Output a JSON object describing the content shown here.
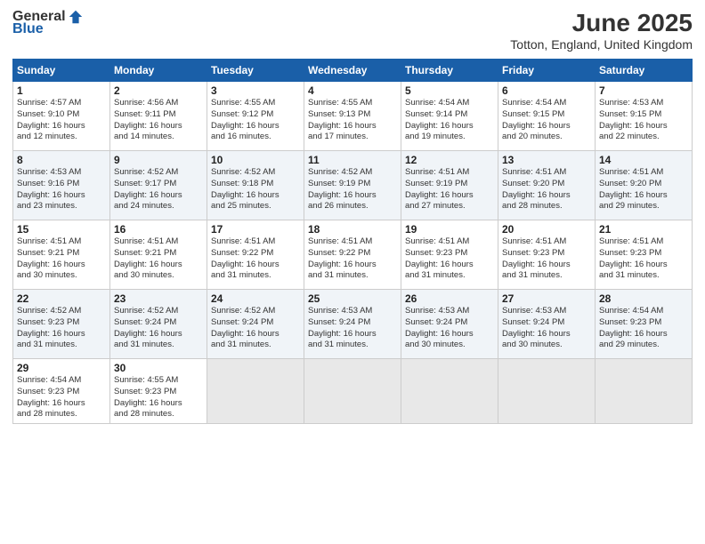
{
  "header": {
    "logo_general": "General",
    "logo_blue": "Blue",
    "title": "June 2025",
    "subtitle": "Totton, England, United Kingdom"
  },
  "calendar": {
    "days_of_week": [
      "Sunday",
      "Monday",
      "Tuesday",
      "Wednesday",
      "Thursday",
      "Friday",
      "Saturday"
    ],
    "weeks": [
      [
        {
          "day": "1",
          "info": "Sunrise: 4:57 AM\nSunset: 9:10 PM\nDaylight: 16 hours\nand 12 minutes."
        },
        {
          "day": "2",
          "info": "Sunrise: 4:56 AM\nSunset: 9:11 PM\nDaylight: 16 hours\nand 14 minutes."
        },
        {
          "day": "3",
          "info": "Sunrise: 4:55 AM\nSunset: 9:12 PM\nDaylight: 16 hours\nand 16 minutes."
        },
        {
          "day": "4",
          "info": "Sunrise: 4:55 AM\nSunset: 9:13 PM\nDaylight: 16 hours\nand 17 minutes."
        },
        {
          "day": "5",
          "info": "Sunrise: 4:54 AM\nSunset: 9:14 PM\nDaylight: 16 hours\nand 19 minutes."
        },
        {
          "day": "6",
          "info": "Sunrise: 4:54 AM\nSunset: 9:15 PM\nDaylight: 16 hours\nand 20 minutes."
        },
        {
          "day": "7",
          "info": "Sunrise: 4:53 AM\nSunset: 9:15 PM\nDaylight: 16 hours\nand 22 minutes."
        }
      ],
      [
        {
          "day": "8",
          "info": "Sunrise: 4:53 AM\nSunset: 9:16 PM\nDaylight: 16 hours\nand 23 minutes."
        },
        {
          "day": "9",
          "info": "Sunrise: 4:52 AM\nSunset: 9:17 PM\nDaylight: 16 hours\nand 24 minutes."
        },
        {
          "day": "10",
          "info": "Sunrise: 4:52 AM\nSunset: 9:18 PM\nDaylight: 16 hours\nand 25 minutes."
        },
        {
          "day": "11",
          "info": "Sunrise: 4:52 AM\nSunset: 9:19 PM\nDaylight: 16 hours\nand 26 minutes."
        },
        {
          "day": "12",
          "info": "Sunrise: 4:51 AM\nSunset: 9:19 PM\nDaylight: 16 hours\nand 27 minutes."
        },
        {
          "day": "13",
          "info": "Sunrise: 4:51 AM\nSunset: 9:20 PM\nDaylight: 16 hours\nand 28 minutes."
        },
        {
          "day": "14",
          "info": "Sunrise: 4:51 AM\nSunset: 9:20 PM\nDaylight: 16 hours\nand 29 minutes."
        }
      ],
      [
        {
          "day": "15",
          "info": "Sunrise: 4:51 AM\nSunset: 9:21 PM\nDaylight: 16 hours\nand 30 minutes."
        },
        {
          "day": "16",
          "info": "Sunrise: 4:51 AM\nSunset: 9:21 PM\nDaylight: 16 hours\nand 30 minutes."
        },
        {
          "day": "17",
          "info": "Sunrise: 4:51 AM\nSunset: 9:22 PM\nDaylight: 16 hours\nand 31 minutes."
        },
        {
          "day": "18",
          "info": "Sunrise: 4:51 AM\nSunset: 9:22 PM\nDaylight: 16 hours\nand 31 minutes."
        },
        {
          "day": "19",
          "info": "Sunrise: 4:51 AM\nSunset: 9:23 PM\nDaylight: 16 hours\nand 31 minutes."
        },
        {
          "day": "20",
          "info": "Sunrise: 4:51 AM\nSunset: 9:23 PM\nDaylight: 16 hours\nand 31 minutes."
        },
        {
          "day": "21",
          "info": "Sunrise: 4:51 AM\nSunset: 9:23 PM\nDaylight: 16 hours\nand 31 minutes."
        }
      ],
      [
        {
          "day": "22",
          "info": "Sunrise: 4:52 AM\nSunset: 9:23 PM\nDaylight: 16 hours\nand 31 minutes."
        },
        {
          "day": "23",
          "info": "Sunrise: 4:52 AM\nSunset: 9:24 PM\nDaylight: 16 hours\nand 31 minutes."
        },
        {
          "day": "24",
          "info": "Sunrise: 4:52 AM\nSunset: 9:24 PM\nDaylight: 16 hours\nand 31 minutes."
        },
        {
          "day": "25",
          "info": "Sunrise: 4:53 AM\nSunset: 9:24 PM\nDaylight: 16 hours\nand 31 minutes."
        },
        {
          "day": "26",
          "info": "Sunrise: 4:53 AM\nSunset: 9:24 PM\nDaylight: 16 hours\nand 30 minutes."
        },
        {
          "day": "27",
          "info": "Sunrise: 4:53 AM\nSunset: 9:24 PM\nDaylight: 16 hours\nand 30 minutes."
        },
        {
          "day": "28",
          "info": "Sunrise: 4:54 AM\nSunset: 9:23 PM\nDaylight: 16 hours\nand 29 minutes."
        }
      ],
      [
        {
          "day": "29",
          "info": "Sunrise: 4:54 AM\nSunset: 9:23 PM\nDaylight: 16 hours\nand 28 minutes."
        },
        {
          "day": "30",
          "info": "Sunrise: 4:55 AM\nSunset: 9:23 PM\nDaylight: 16 hours\nand 28 minutes."
        },
        {
          "day": "",
          "info": ""
        },
        {
          "day": "",
          "info": ""
        },
        {
          "day": "",
          "info": ""
        },
        {
          "day": "",
          "info": ""
        },
        {
          "day": "",
          "info": ""
        }
      ]
    ]
  }
}
